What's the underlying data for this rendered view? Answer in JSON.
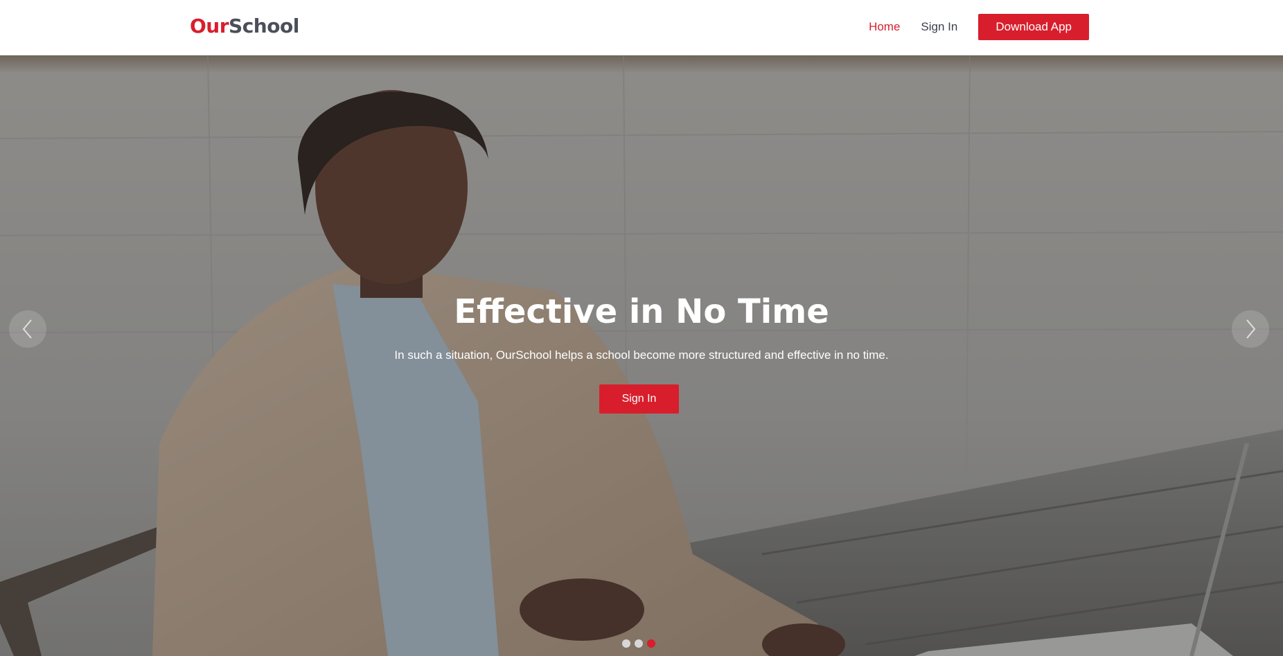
{
  "brand": {
    "part1": "Our",
    "part2": "School",
    "accent_color": "#d81e2c",
    "text_color": "#4a4f5a"
  },
  "nav": {
    "items": [
      {
        "label": "Home",
        "active": true
      },
      {
        "label": "Sign In",
        "active": false
      }
    ],
    "download_label": "Download App"
  },
  "hero": {
    "title": "Effective in No Time",
    "subtitle": "In such a situation, OurSchool helps a school become more structured and effective in no time.",
    "cta_label": "Sign In",
    "prev_icon": "chevron-left-icon",
    "next_icon": "chevron-right-icon",
    "slides_count": 3,
    "active_slide": 3
  }
}
